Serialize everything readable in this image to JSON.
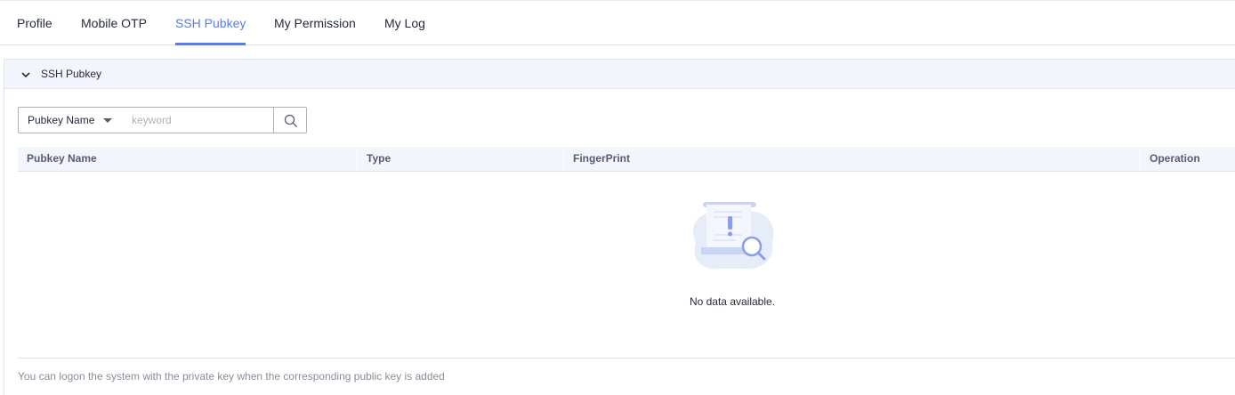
{
  "tabs": [
    {
      "label": "Profile",
      "active": false
    },
    {
      "label": "Mobile OTP",
      "active": false
    },
    {
      "label": "SSH Pubkey",
      "active": true
    },
    {
      "label": "My Permission",
      "active": false
    },
    {
      "label": "My Log",
      "active": false
    }
  ],
  "panel": {
    "title": "SSH Pubkey",
    "expanded": true
  },
  "search": {
    "field_selected": "Pubkey Name",
    "placeholder": "keyword",
    "value": ""
  },
  "table": {
    "columns": [
      "Pubkey Name",
      "Type",
      "FingerPrint",
      "Operation"
    ],
    "rows": [],
    "empty_text": "No data available."
  },
  "footer": {
    "note": "You can logon the system with the private key when the corresponding public key is added"
  },
  "colors": {
    "accent": "#5e7ce0",
    "header_bg": "#f2f5fc",
    "text": "#252b3a",
    "muted": "#8a8e99"
  },
  "icons": {
    "panel_toggle": "chevron-down-icon",
    "search": "search-icon",
    "empty": "empty-document-search-icon"
  }
}
